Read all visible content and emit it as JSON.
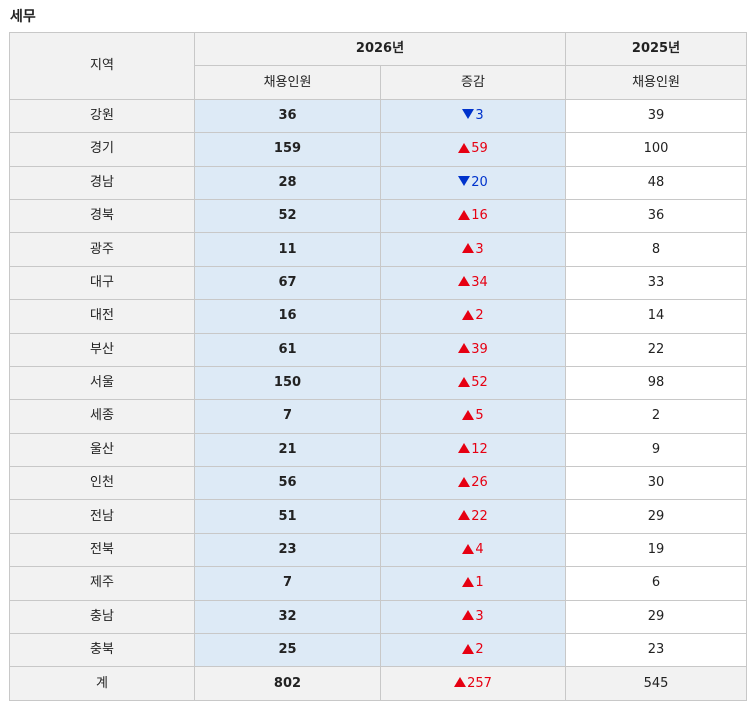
{
  "page": {
    "title": "세무"
  },
  "table": {
    "headers": {
      "region": "지역",
      "year_2026": "2026년",
      "year_2025": "2025년",
      "hire": "채용인원",
      "change": "증감",
      "hire_2025": "채용인원"
    },
    "rows": [
      {
        "region": "강원",
        "hire_2026": "36",
        "change_dir": "down",
        "change": "3",
        "hire_2025": "39"
      },
      {
        "region": "경기",
        "hire_2026": "159",
        "change_dir": "up",
        "change": "59",
        "hire_2025": "100"
      },
      {
        "region": "경남",
        "hire_2026": "28",
        "change_dir": "down",
        "change": "20",
        "hire_2025": "48"
      },
      {
        "region": "경북",
        "hire_2026": "52",
        "change_dir": "up",
        "change": "16",
        "hire_2025": "36"
      },
      {
        "region": "광주",
        "hire_2026": "11",
        "change_dir": "up",
        "change": "3",
        "hire_2025": "8"
      },
      {
        "region": "대구",
        "hire_2026": "67",
        "change_dir": "up",
        "change": "34",
        "hire_2025": "33"
      },
      {
        "region": "대전",
        "hire_2026": "16",
        "change_dir": "up",
        "change": "2",
        "hire_2025": "14"
      },
      {
        "region": "부산",
        "hire_2026": "61",
        "change_dir": "up",
        "change": "39",
        "hire_2025": "22"
      },
      {
        "region": "서울",
        "hire_2026": "150",
        "change_dir": "up",
        "change": "52",
        "hire_2025": "98"
      },
      {
        "region": "세종",
        "hire_2026": "7",
        "change_dir": "up",
        "change": "5",
        "hire_2025": "2"
      },
      {
        "region": "울산",
        "hire_2026": "21",
        "change_dir": "up",
        "change": "12",
        "hire_2025": "9"
      },
      {
        "region": "인천",
        "hire_2026": "56",
        "change_dir": "up",
        "change": "26",
        "hire_2025": "30"
      },
      {
        "region": "전남",
        "hire_2026": "51",
        "change_dir": "up",
        "change": "22",
        "hire_2025": "29"
      },
      {
        "region": "전북",
        "hire_2026": "23",
        "change_dir": "up",
        "change": "4",
        "hire_2025": "19"
      },
      {
        "region": "제주",
        "hire_2026": "7",
        "change_dir": "up",
        "change": "1",
        "hire_2025": "6"
      },
      {
        "region": "충남",
        "hire_2026": "32",
        "change_dir": "up",
        "change": "3",
        "hire_2025": "29"
      },
      {
        "region": "충북",
        "hire_2026": "25",
        "change_dir": "up",
        "change": "2",
        "hire_2025": "23"
      }
    ],
    "total": {
      "region": "계",
      "hire_2026": "802",
      "change_dir": "up",
      "change": "257",
      "hire_2025": "545"
    },
    "icons": {
      "up": "triangle-up-icon",
      "down": "triangle-down-icon"
    },
    "colors": {
      "increase": "#e60012",
      "decrease": "#0033cc",
      "highlight_column": "#ddeaf6",
      "header_background": "#f2f2f2"
    }
  }
}
